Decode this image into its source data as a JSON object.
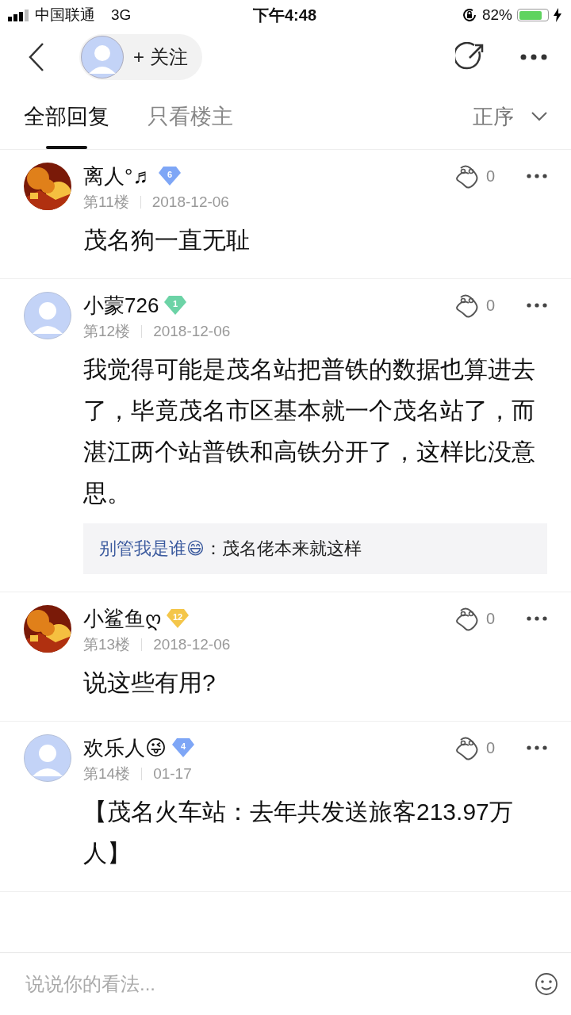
{
  "status_bar": {
    "carrier": "中国联通",
    "network": "3G",
    "time": "下午4:48",
    "battery": "82%",
    "level": 0.82,
    "charging": true
  },
  "header": {
    "follow": "+ 关注"
  },
  "tabs": [
    {
      "label": "全部回复",
      "selected": true
    },
    {
      "label": "只看楼主",
      "selected": false
    }
  ],
  "sort": "正序",
  "posts": [
    {
      "photo": true,
      "name": "离人°♬",
      "level": "6",
      "color": "#7ea6f6",
      "floor": "第11楼",
      "date": "2018-12-06",
      "content": "茂名狗一直无耻",
      "likes": "0"
    },
    {
      "photo": false,
      "name": "小蒙726",
      "level": "1",
      "color": "#6cd3a6",
      "floor": "第12楼",
      "date": "2018-12-06",
      "content": "我觉得可能是茂名站把普铁的数据也算进去了，毕竟茂名市区基本就一个茂名站了，而湛江两个站普铁和高铁分开了，这样比没意思。",
      "likes": "0",
      "replies": [
        {
          "user": "别管我是谁😄",
          "text": "：茂名佬本来就这样"
        }
      ]
    },
    {
      "photo": true,
      "name": "小鲨鱼ღ",
      "level": "12",
      "color": "#f4c64a",
      "floor": "第13楼",
      "date": "2018-12-06",
      "content": "说这些有用?",
      "likes": "0"
    },
    {
      "photo": false,
      "name": "欢乐人😜",
      "level": "4",
      "color": "#7ea6f6",
      "floor": "第14楼",
      "date": "01-17",
      "content": "【茂名火车站：去年共发送旅客213.97万人】",
      "likes": "0"
    }
  ],
  "input": {
    "placeholder": "说说你的看法..."
  }
}
